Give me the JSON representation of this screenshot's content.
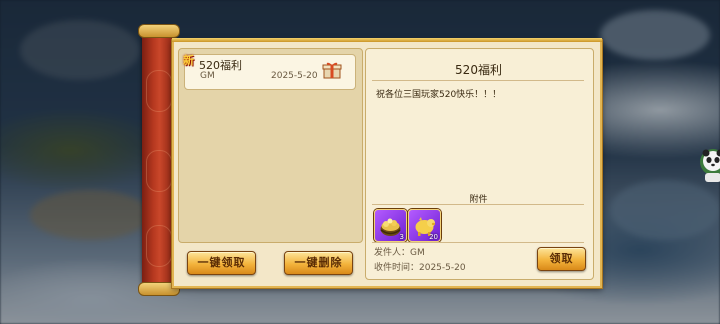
{
  "mail_list": {
    "items": [
      {
        "badge": "新",
        "title": "520福利",
        "sender": "GM",
        "date": "2025-5-20",
        "icon": "gift-icon"
      }
    ]
  },
  "detail": {
    "title": "520福利",
    "body": "祝各位三国玩家520快乐！！！",
    "attachments_label": "附件",
    "attachments": [
      {
        "icon": "gold-treasure-icon",
        "count": "3"
      },
      {
        "icon": "gold-pig-icon",
        "count": "20"
      }
    ],
    "sender_line": "发件人：GM",
    "time_line": "收件时间：2025-5-20"
  },
  "buttons": {
    "claim_all": "一键领取",
    "delete_all": "一键删除",
    "claim": "领取"
  },
  "colors": {
    "panel": "#f3e7c8",
    "border_gold": "#e2b552",
    "button_gold": "#f3b33c",
    "rod_red": "#b5381f",
    "attachment_purple": "#8a3be8"
  }
}
